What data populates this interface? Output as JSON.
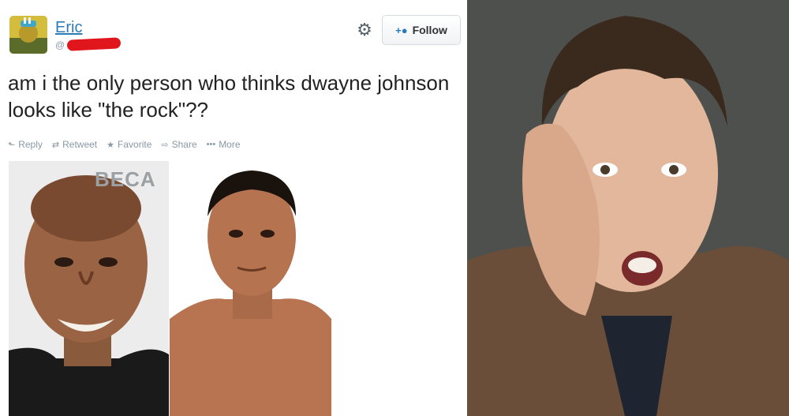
{
  "tweet": {
    "display_name": "Eric",
    "handle_prefix": "@",
    "text": "am i the only person who thinks dwayne johnson looks like \"the rock\"??",
    "follow_label": "Follow",
    "actions": {
      "reply": "Reply",
      "retweet": "Retweet",
      "favorite": "Favorite",
      "share": "Share",
      "more": "More"
    }
  },
  "photos": {
    "backdrop_text": "BECA"
  },
  "icons": {
    "settings": "gear-icon",
    "follow": "add-user-icon",
    "reply": "reply-icon",
    "retweet": "retweet-icon",
    "favorite": "star-icon",
    "share": "share-icon",
    "more": "ellipsis-icon"
  },
  "colors": {
    "link": "#2b7bb9",
    "muted": "#8899a6",
    "text": "#222222",
    "redaction": "#e0161c"
  }
}
